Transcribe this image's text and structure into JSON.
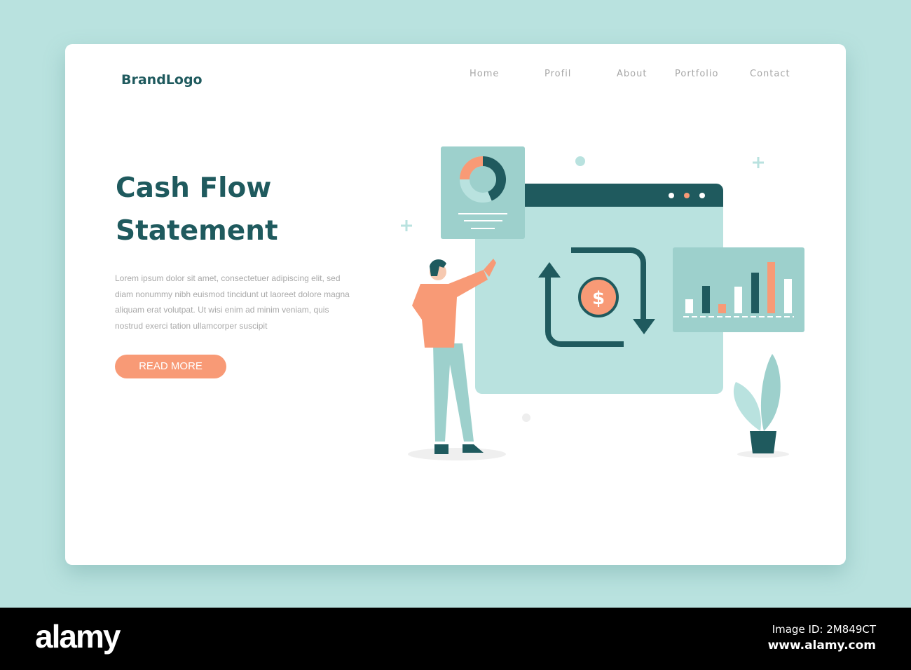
{
  "brand": "BrandLogo",
  "nav": [
    "Home",
    "Profil",
    "About",
    "Portfolio",
    "Contact"
  ],
  "hero": {
    "title_line1": "Cash Flow",
    "title_line2": "Statement",
    "body": "Lorem ipsum dolor sit amet, consectetuer adipiscing elit, sed diam nonummy nibh euismod tincidunt ut laoreet dolore magna aliquam erat volutpat. Ut wisi enim ad minim veniam, quis nostrud exerci tation ullamcorper suscipit",
    "button": "READ MORE"
  },
  "illustration": {
    "currency_symbol": "$"
  },
  "footer": {
    "logo": "alamy",
    "image_id": "Image ID: 2M849CT",
    "url": "www.alamy.com"
  },
  "colors": {
    "background": "#b9e2df",
    "dark_teal": "#1f5a5e",
    "accent": "#f89a76",
    "panel": "#b9e2df"
  }
}
